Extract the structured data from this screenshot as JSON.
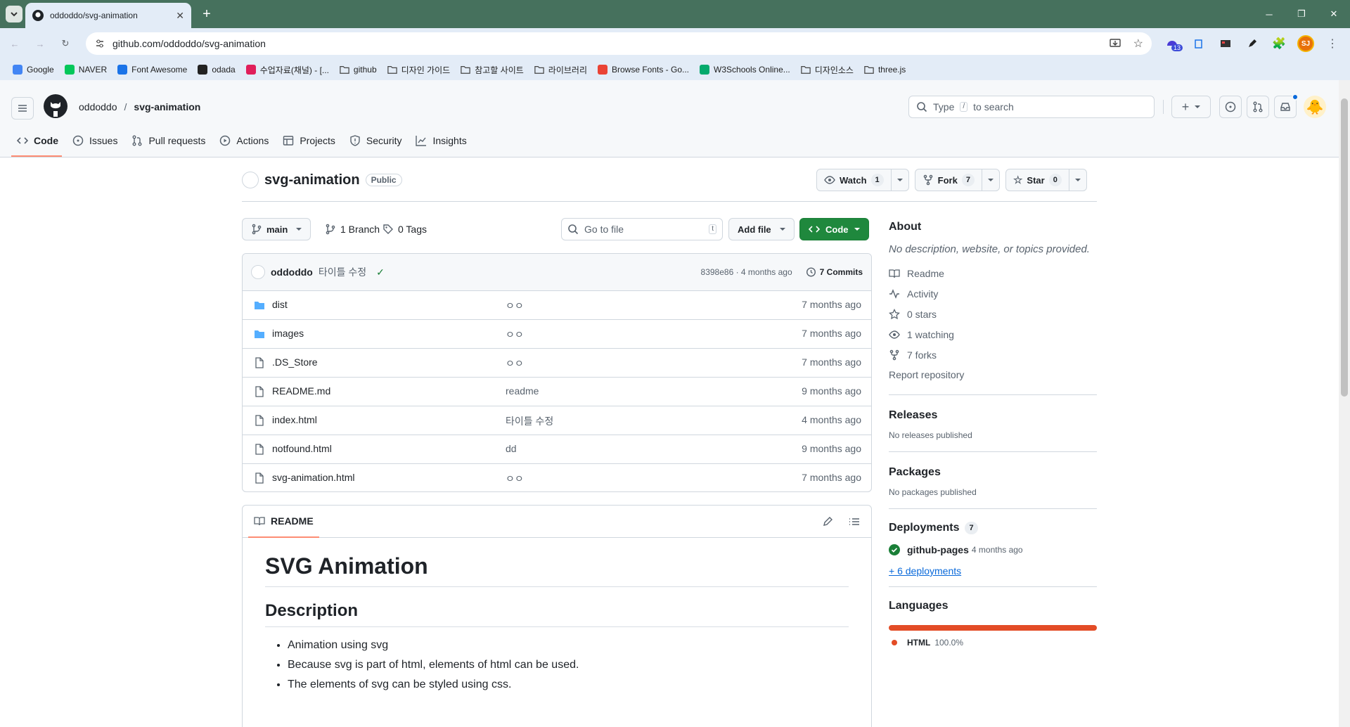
{
  "browser": {
    "tab_title": "oddoddo/svg-animation",
    "url": "github.com/oddoddo/svg-animation",
    "extension_badge": "13",
    "profile": "SJ",
    "bookmarks": [
      {
        "label": "Google",
        "icon": "google-icon"
      },
      {
        "label": "NAVER",
        "icon": "naver-icon"
      },
      {
        "label": "Font Awesome",
        "icon": "flag-icon"
      },
      {
        "label": "odada",
        "icon": "odada-icon"
      },
      {
        "label": "수업자료(채널) - [...",
        "icon": "slack-icon"
      },
      {
        "label": "github",
        "icon": "folder-icon"
      },
      {
        "label": "디자인 가이드",
        "icon": "folder-icon"
      },
      {
        "label": "참고할 사이트",
        "icon": "folder-icon"
      },
      {
        "label": "라이브러리",
        "icon": "folder-icon"
      },
      {
        "label": "Browse Fonts - Go...",
        "icon": "google-fonts-icon"
      },
      {
        "label": "W3Schools Online...",
        "icon": "w3schools-icon"
      },
      {
        "label": "디자인소스",
        "icon": "folder-icon"
      },
      {
        "label": "three.js",
        "icon": "folder-icon"
      }
    ]
  },
  "github": {
    "owner": "oddoddo",
    "separator": "/",
    "repo": "svg-animation",
    "search_placeholder_prefix": "Type",
    "search_key": "/",
    "search_placeholder_suffix": "to search",
    "tabs": [
      {
        "label": "Code",
        "icon": "code-icon"
      },
      {
        "label": "Issues",
        "icon": "issue-icon"
      },
      {
        "label": "Pull requests",
        "icon": "pull-request-icon"
      },
      {
        "label": "Actions",
        "icon": "play-icon"
      },
      {
        "label": "Projects",
        "icon": "table-icon"
      },
      {
        "label": "Security",
        "icon": "shield-icon"
      },
      {
        "label": "Insights",
        "icon": "graph-icon"
      }
    ]
  },
  "repo": {
    "name": "svg-animation",
    "visibility": "Public",
    "watch_label": "Watch",
    "watch_count": "1",
    "fork_label": "Fork",
    "fork_count": "7",
    "star_label": "Star",
    "star_count": "0",
    "branch": "main",
    "branch_count": "1 Branch",
    "tag_count": "0 Tags",
    "goto_placeholder": "Go to file",
    "goto_key": "t",
    "add_file": "Add file",
    "code_button": "Code",
    "commit": {
      "author": "oddoddo",
      "message": "타이틀 수정",
      "hash_time": "8398e86 · 4 months ago",
      "commits": "7 Commits"
    },
    "files": [
      {
        "name": "dist",
        "type": "folder",
        "message": "ㅇㅇ",
        "date": "7 months ago"
      },
      {
        "name": "images",
        "type": "folder",
        "message": "ㅇㅇ",
        "date": "7 months ago"
      },
      {
        "name": ".DS_Store",
        "type": "file",
        "message": "ㅇㅇ",
        "date": "7 months ago"
      },
      {
        "name": "README.md",
        "type": "file",
        "message": "readme",
        "date": "9 months ago"
      },
      {
        "name": "index.html",
        "type": "file",
        "message": "타이틀 수정",
        "date": "4 months ago"
      },
      {
        "name": "notfound.html",
        "type": "file",
        "message": "dd",
        "date": "9 months ago"
      },
      {
        "name": "svg-animation.html",
        "type": "file",
        "message": "ㅇㅇ",
        "date": "7 months ago"
      }
    ],
    "readme": {
      "tab": "README",
      "h1": "SVG Animation",
      "h2": "Description",
      "bullets": [
        "Animation using svg",
        "Because svg is part of html, elements of html can be used.",
        "The elements of svg can be styled using css."
      ]
    }
  },
  "sidebar": {
    "about_title": "About",
    "about_desc": "No description, website, or topics provided.",
    "links": [
      {
        "label": "Readme",
        "icon": "book-icon"
      },
      {
        "label": "Activity",
        "icon": "pulse-icon"
      },
      {
        "label": "0 stars",
        "icon": "star-icon"
      },
      {
        "label": "1 watching",
        "icon": "eye-icon"
      },
      {
        "label": "7 forks",
        "icon": "fork-icon"
      }
    ],
    "report": "Report repository",
    "releases_title": "Releases",
    "releases_text": "No releases published",
    "packages_title": "Packages",
    "packages_text": "No packages published",
    "deployments_title": "Deployments",
    "deployments_count": "7",
    "deployment_name": "github-pages",
    "deployment_time": "4 months ago",
    "more_deployments": "+ 6 deployments",
    "languages_title": "Languages",
    "language_name": "HTML",
    "language_pct": "100.0%",
    "language_share": 1.0,
    "colors": {
      "html": "#e34c26",
      "success": "#1a7f37",
      "accent": "#fd8c73",
      "link": "#0969da"
    }
  }
}
